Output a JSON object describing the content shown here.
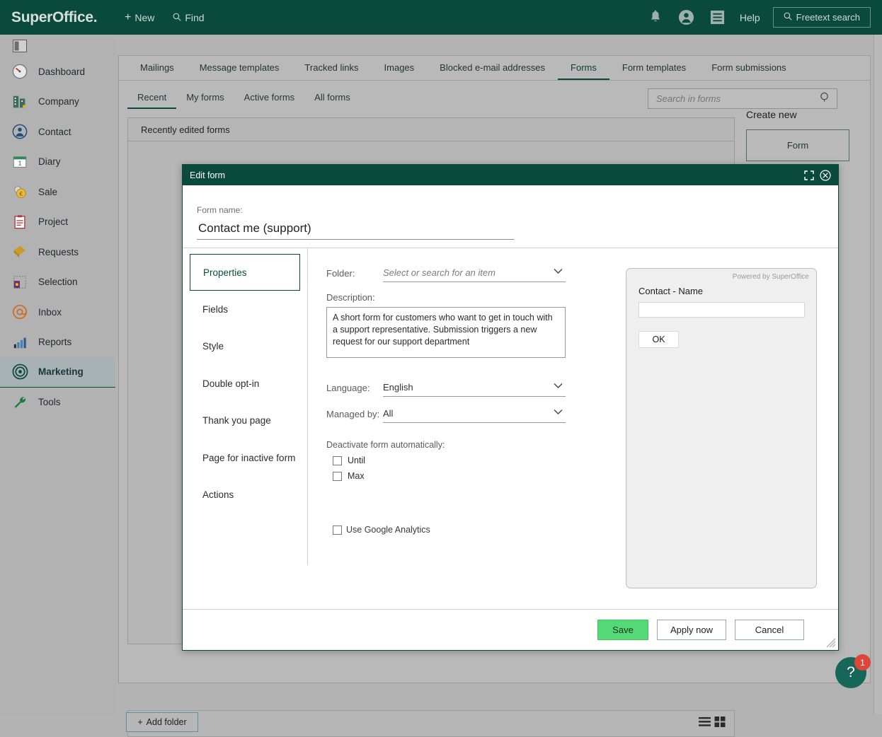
{
  "topbar": {
    "brand": "SuperOffice",
    "brand_dot": ".",
    "new_label": "New",
    "find_label": "Find",
    "help_label": "Help",
    "freetext_label": "Freetext search",
    "icons": {
      "bell": "bell-icon",
      "user": "user-avatar-icon",
      "menu": "list-menu-icon",
      "search": "search-icon"
    },
    "bg_color": "#0a4a3c"
  },
  "sidebar": {
    "items": [
      {
        "label": "Dashboard",
        "icon": "gauge-icon"
      },
      {
        "label": "Company",
        "icon": "building-icon"
      },
      {
        "label": "Contact",
        "icon": "person-icon"
      },
      {
        "label": "Diary",
        "icon": "calendar-icon"
      },
      {
        "label": "Sale",
        "icon": "coins-icon"
      },
      {
        "label": "Project",
        "icon": "clipboard-icon"
      },
      {
        "label": "Requests",
        "icon": "ticket-icon"
      },
      {
        "label": "Selection",
        "icon": "grid-selection-icon"
      },
      {
        "label": "Inbox",
        "icon": "at-sign-icon"
      },
      {
        "label": "Reports",
        "icon": "bar-chart-icon"
      },
      {
        "label": "Marketing",
        "icon": "target-icon",
        "active": true
      },
      {
        "label": "Tools",
        "icon": "wrench-icon"
      }
    ]
  },
  "main": {
    "tabs": [
      {
        "label": "Mailings"
      },
      {
        "label": "Message templates"
      },
      {
        "label": "Tracked links"
      },
      {
        "label": "Images"
      },
      {
        "label": "Blocked e-mail addresses"
      },
      {
        "label": "Forms",
        "active": true
      },
      {
        "label": "Form templates"
      },
      {
        "label": "Form submissions"
      }
    ],
    "subtabs": [
      {
        "label": "Recent",
        "active": true
      },
      {
        "label": "My forms"
      },
      {
        "label": "Active forms"
      },
      {
        "label": "All forms"
      }
    ],
    "search": {
      "placeholder": "Search in forms",
      "value": ""
    },
    "list_header": "Recently edited forms",
    "create_new": {
      "title": "Create new",
      "button": "Form"
    },
    "add_folder": "Add folder",
    "view_toggle": {
      "list": "list-view-icon",
      "grid": "grid-view-icon"
    }
  },
  "dialog": {
    "title": "Edit form",
    "maximize_icon": "maximize-icon",
    "close_icon": "close-icon",
    "form_name_label": "Form name:",
    "form_name_value": "Contact me (support)",
    "nav": [
      {
        "label": "Properties",
        "active": true
      },
      {
        "label": "Fields"
      },
      {
        "label": "Style"
      },
      {
        "label": "Double opt-in"
      },
      {
        "label": "Thank you page"
      },
      {
        "label": "Page for inactive form"
      },
      {
        "label": "Actions"
      }
    ],
    "fields": {
      "folder_label": "Folder:",
      "folder_placeholder": "Select or search for an item",
      "description_label": "Description:",
      "description_value": "A short form for customers who want to get in touch with a support representative. Submission triggers a new request for our support department",
      "language_label": "Language:",
      "language_value": "English",
      "managed_by_label": "Managed by:",
      "managed_by_value": "All",
      "deactivate_label": "Deactivate form automatically:",
      "until_label": "Until",
      "until_checked": false,
      "max_label": "Max",
      "max_checked": false,
      "google_analytics_label": "Use Google Analytics",
      "google_analytics_checked": false
    },
    "preview": {
      "powered_by": "Powered by SuperOffice",
      "field_label": "Contact - Name",
      "field_value": "",
      "ok_button": "OK"
    },
    "footer": {
      "save": "Save",
      "apply": "Apply now",
      "cancel": "Cancel",
      "save_color": "#55d977"
    }
  },
  "help_widget": {
    "glyph": "?",
    "badge_count": "1",
    "badge_color": "#e0453a"
  }
}
